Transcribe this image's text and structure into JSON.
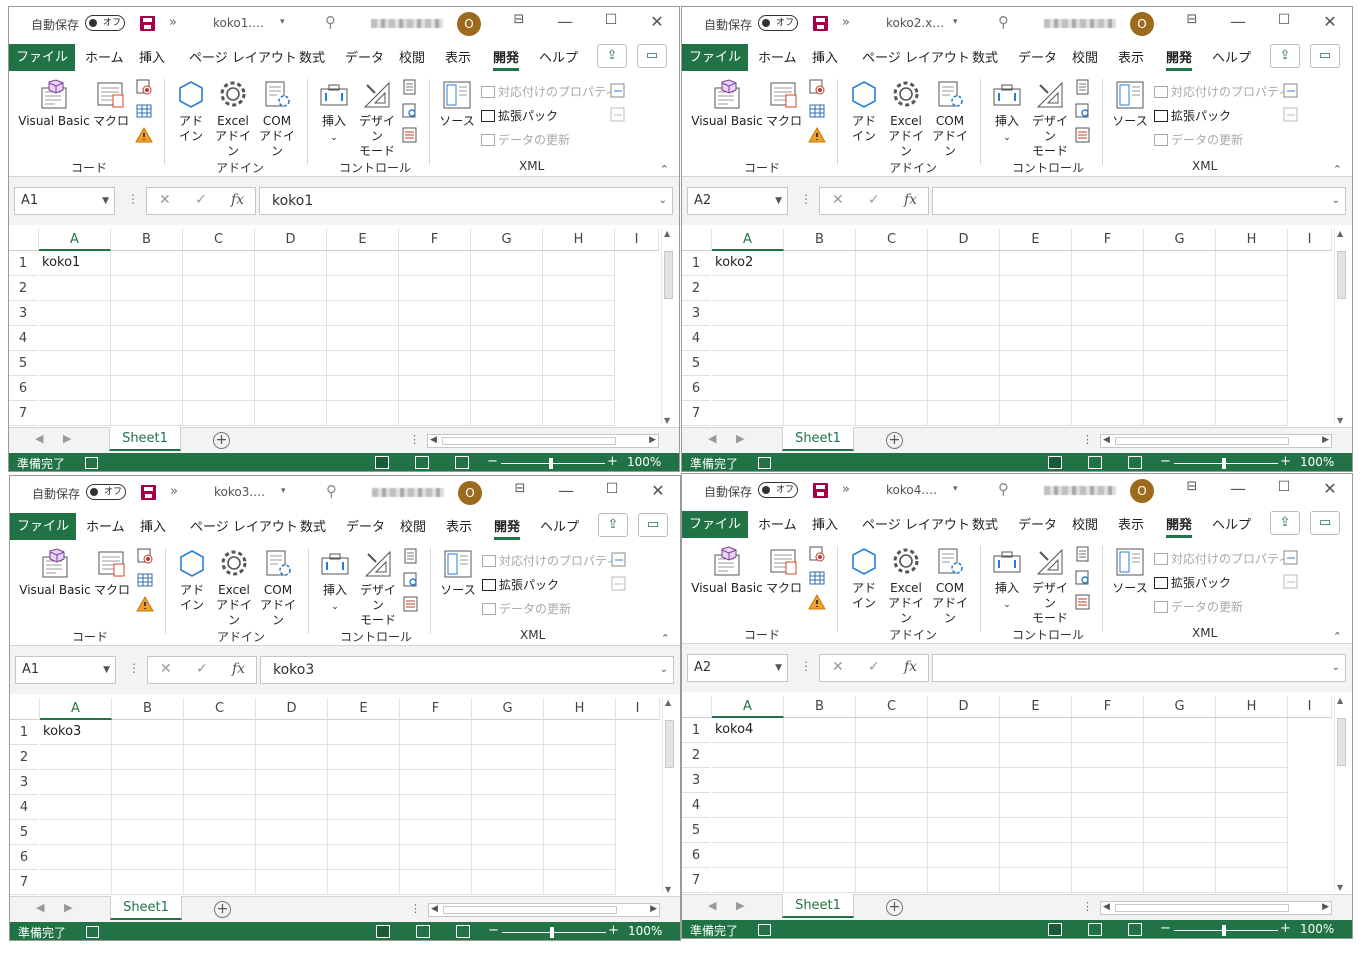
{
  "common": {
    "autosave_label": "自動保存",
    "autosave_state": "オフ",
    "qat_more": "»",
    "avatar_initial": "O",
    "tabs": [
      "ファイル",
      "ホーム",
      "挿入",
      "ページ レイアウト",
      "数式",
      "データ",
      "校閲",
      "表示",
      "開発",
      "ヘルプ"
    ],
    "ribbon": {
      "visual_basic": "Visual Basic",
      "macro": "マクロ",
      "addin_1": "アド",
      "addin_2": "イン",
      "excel_addin_1": "Excel",
      "excel_addin_2": "アドイン",
      "com_addin_1": "COM",
      "com_addin_2": "アドイン",
      "insert": "挿入",
      "design_mode_1": "デザイン",
      "design_mode_2": "モード",
      "source": "ソース",
      "map_properties": "対応付けのプロパティ",
      "expansion_packs": "拡張パック",
      "refresh_data": "データの更新",
      "group_code": "コード",
      "group_addins": "アドイン",
      "group_controls": "コントロール",
      "group_xml": "XML"
    },
    "columns": [
      "A",
      "B",
      "C",
      "D",
      "E",
      "F",
      "G",
      "H",
      "I"
    ],
    "rows": [
      "1",
      "2",
      "3",
      "4",
      "5",
      "6",
      "7"
    ],
    "sheet_tab": "Sheet1",
    "status": "準備完了",
    "zoom": "100%",
    "colors": {
      "excel_green": "#217346",
      "avatar": "#9c6a1c",
      "save_icon": "#a4004a"
    }
  },
  "windows": [
    {
      "filename": "koko1.…",
      "name_box": "A1",
      "formula": "koko1",
      "a1": "koko1",
      "selected_col": "A"
    },
    {
      "filename": "koko2.x…",
      "name_box": "A2",
      "formula": "",
      "a1": "koko2",
      "selected_col": "A"
    },
    {
      "filename": "koko3.…",
      "name_box": "A1",
      "formula": "koko3",
      "a1": "koko3",
      "selected_col": "A"
    },
    {
      "filename": "koko4.…",
      "name_box": "A2",
      "formula": "",
      "a1": "koko4",
      "selected_col": "A"
    }
  ]
}
